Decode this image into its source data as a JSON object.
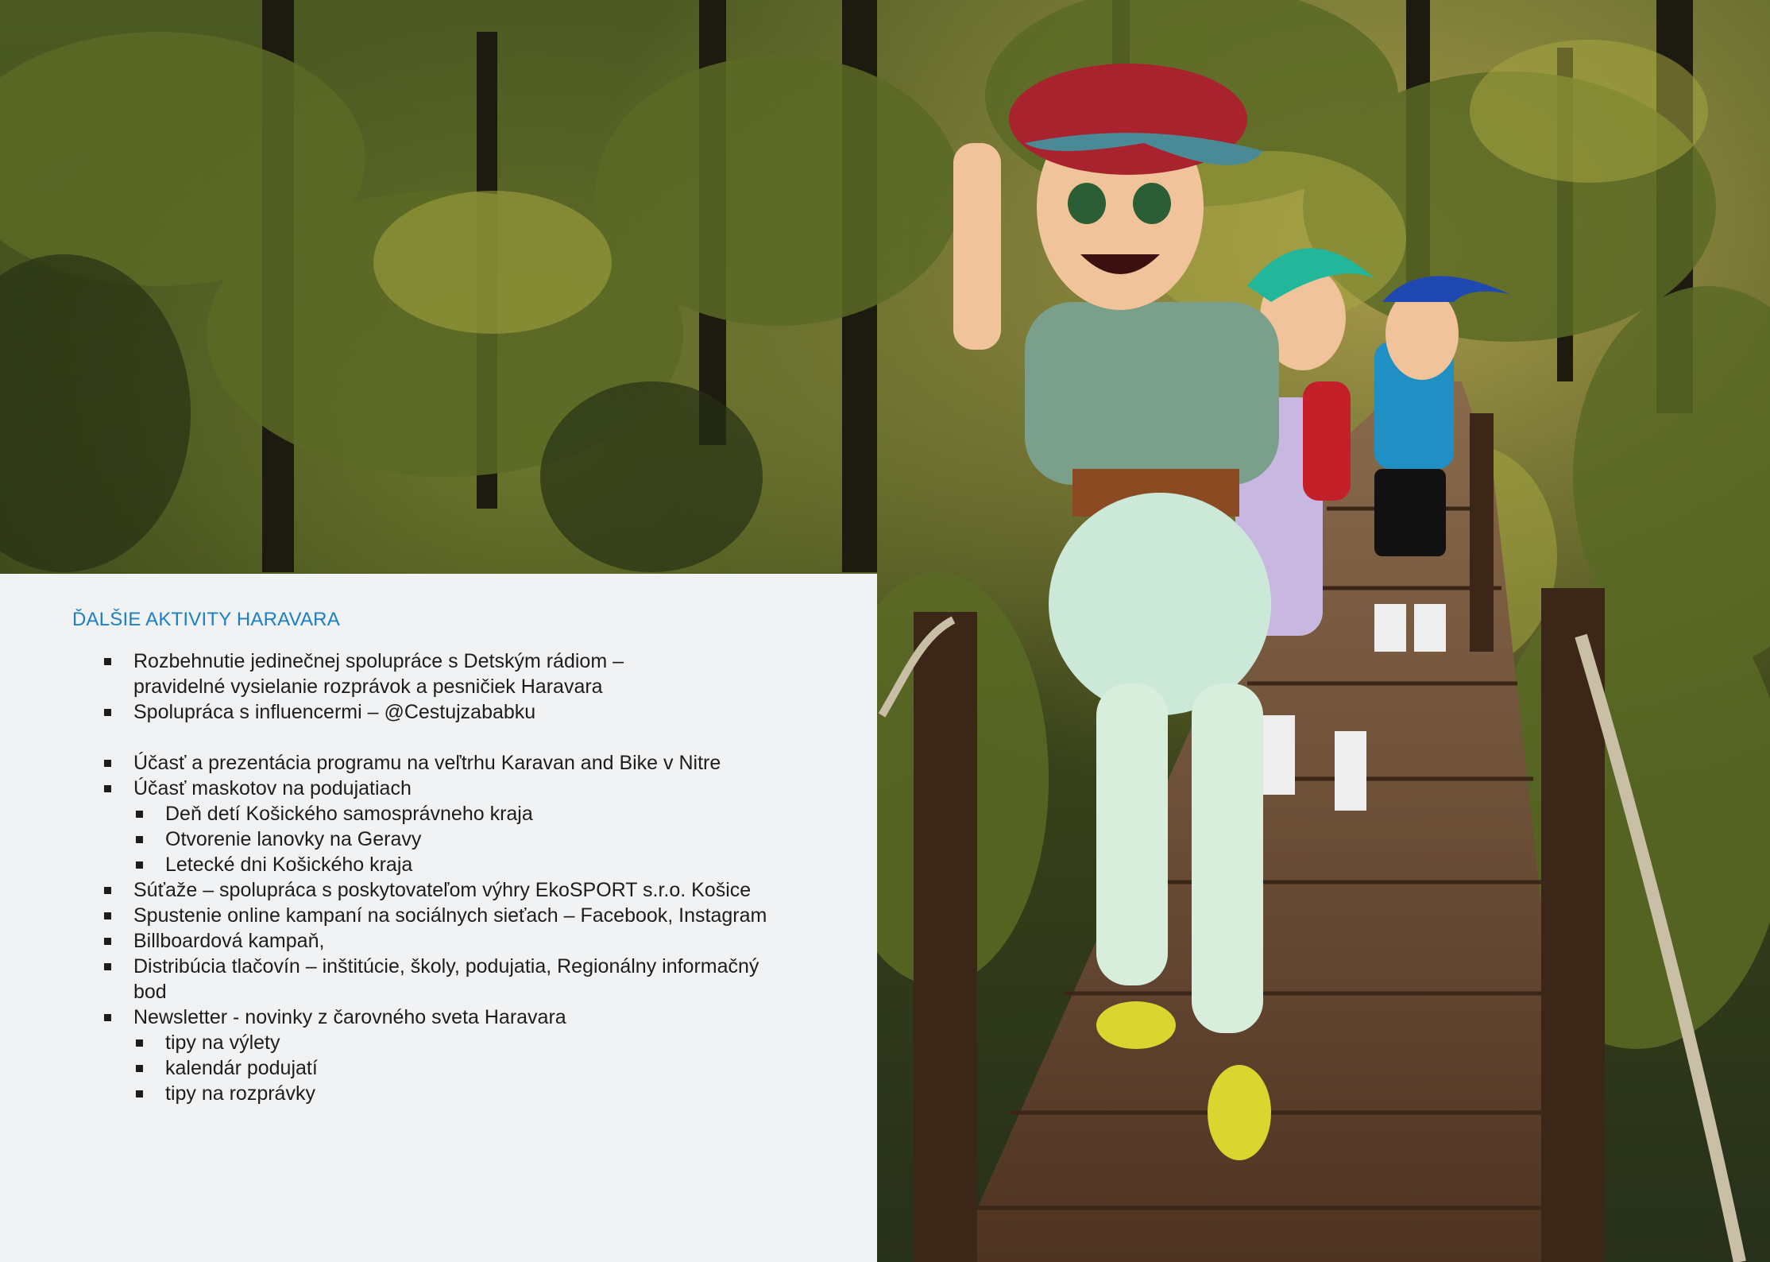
{
  "heading": "ĎALŠIE AKTIVITY HARAVARA",
  "items": [
    {
      "text": "Rozbehnutie jedinečnej spolupráce s Detským rádiom –",
      "text2": "pravidelné vysielanie rozprávok a pesničiek Haravara"
    },
    {
      "text": "Spolupráca s influencermi – @Cestujzababku"
    },
    {
      "text": "Účasť a prezentácia programu na veľtrhu Karavan and Bike v Nitre"
    },
    {
      "text": "Účasť maskotov na podujatiach",
      "subitems": [
        "Deň detí Košického samosprávneho kraja",
        "Otvorenie lanovky na Geravy",
        "Letecké dni Košického kraja"
      ]
    },
    {
      "text": "Súťaže – spolupráca s poskytovateľom výhry EkoSPORT s.r.o. Košice"
    },
    {
      "text": "Spustenie online kampaní na sociálnych sieťach – Facebook, Instagram"
    },
    {
      "text": "Billboardová kampaň,"
    },
    {
      "text": "Distribúcia tlačovín – inštitúcie, školy, podujatia, Regionálny informačný",
      "text2": "bod"
    },
    {
      "text": "Newsletter - novinky z čarovného sveta Haravara",
      "subitems": [
        "tipy na výlety",
        "kalendár podujatí",
        "tipy na rozprávky"
      ]
    }
  ],
  "photo": {
    "mascots": [
      "boy-mascot-red-cap",
      "girl-mascot-teal-hair",
      "boy-mascot-blue-hair"
    ],
    "colors": {
      "foliage_dark": "#263114",
      "foliage_mid": "#5b6a25",
      "foliage_light": "#a6a63f",
      "boardwalk": "#6b4a31",
      "cap_red": "#a8232d",
      "shirt_green": "#7aa08c",
      "trousers_mint": "#d7eedc"
    }
  },
  "colors": {
    "heading": "#1b7fc4",
    "panel_bg": "#f1f2f4",
    "text": "#1d1d1d"
  }
}
